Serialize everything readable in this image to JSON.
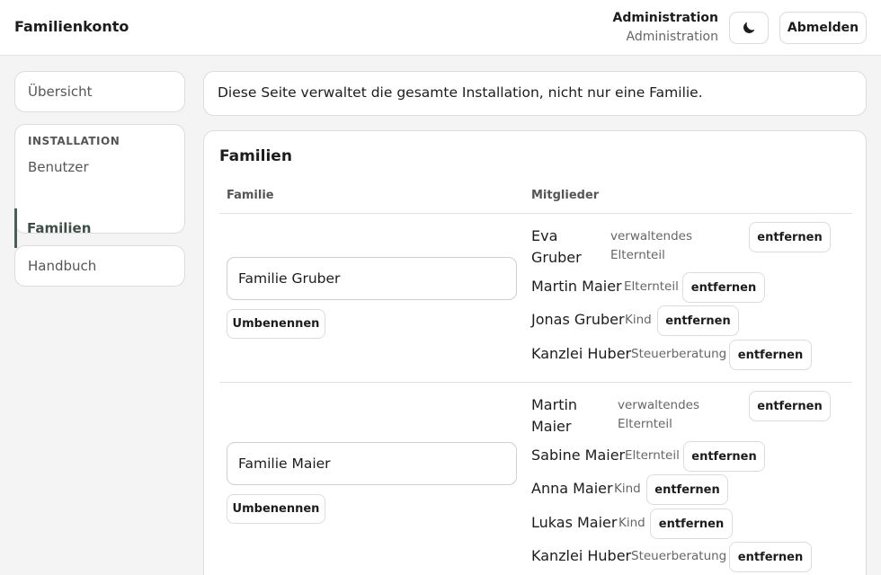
{
  "header": {
    "app_title": "Familienkonto",
    "user_name": "Administration",
    "user_role": "Administration",
    "theme_icon": "moon-icon",
    "logout_label": "Abmelden"
  },
  "sidebar": {
    "overview_label": "Übersicht",
    "installation_section": "INSTALLATION",
    "users_label": "Benutzer",
    "families_label": "Familien",
    "manual_label": "Handbuch"
  },
  "info": {
    "text": "Diese Seite verwaltet die gesamte Installation, nicht nur eine Familie."
  },
  "families_section": {
    "title": "Familien",
    "col_family": "Familie",
    "col_members": "Mitglieder",
    "rename_label": "Umbenennen",
    "remove_label": "entfernen",
    "families": [
      {
        "name": "Familie Gruber",
        "members": [
          {
            "name_line1": "Eva",
            "name_line2": "Gruber",
            "role_line1": "verwaltendes",
            "role_line2": "Elternteil"
          },
          {
            "name": "Martin Maier",
            "role": "Elternteil"
          },
          {
            "name": "Jonas Gruber",
            "role": "Kind"
          },
          {
            "name": "Kanzlei Huber",
            "role": "Steuerberatung"
          }
        ]
      },
      {
        "name": "Familie Maier",
        "members": [
          {
            "name_line1": "Martin",
            "name_line2": "Maier",
            "role_line1": "verwaltendes",
            "role_line2": "Elternteil"
          },
          {
            "name": "Sabine Maier",
            "role": "Elternteil"
          },
          {
            "name": "Anna Maier",
            "role": "Kind"
          },
          {
            "name": "Lukas Maier",
            "role": "Kind"
          },
          {
            "name": "Kanzlei Huber",
            "role": "Steuerberatung"
          }
        ]
      }
    ]
  }
}
